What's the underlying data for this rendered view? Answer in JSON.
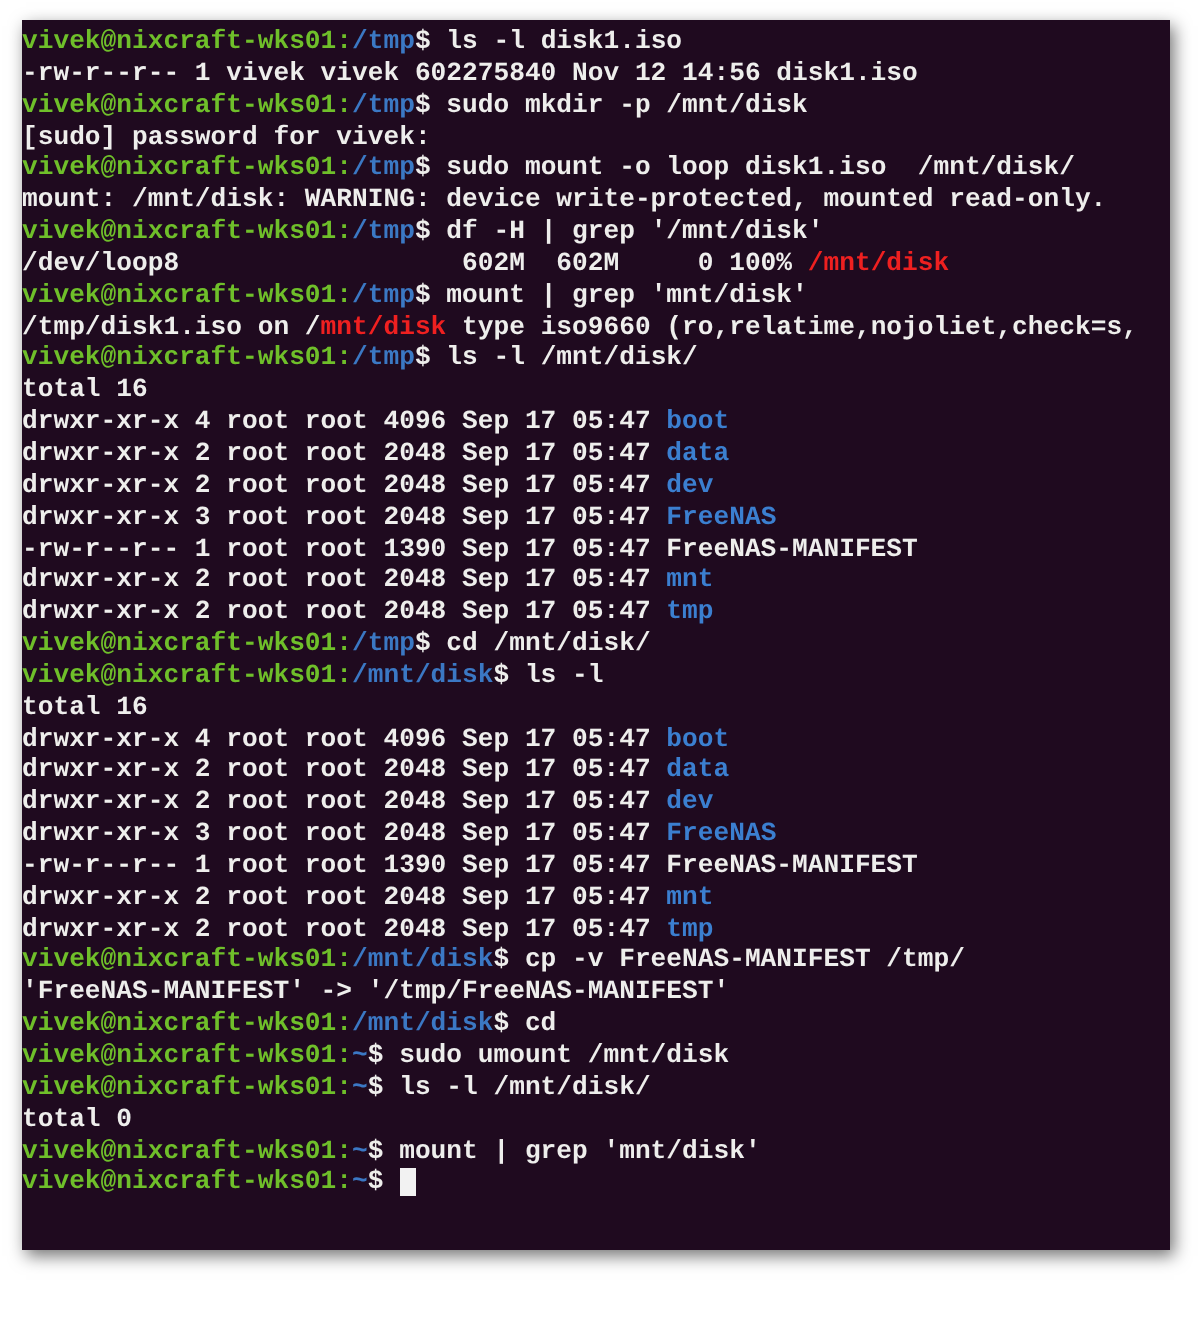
{
  "terminal": {
    "lines": [
      {
        "segments": [
          {
            "kind": "user",
            "text": "vivek@nixcraft-wks01:"
          },
          {
            "kind": "path",
            "text": "/tmp"
          },
          {
            "kind": "text",
            "text": "$ ls -l disk1.iso"
          }
        ]
      },
      {
        "segments": [
          {
            "kind": "text",
            "text": "-rw-r--r-- 1 vivek vivek 602275840 Nov 12 14:56 disk1.iso"
          }
        ]
      },
      {
        "segments": [
          {
            "kind": "user",
            "text": "vivek@nixcraft-wks01:"
          },
          {
            "kind": "path",
            "text": "/tmp"
          },
          {
            "kind": "text",
            "text": "$ sudo mkdir -p /mnt/disk"
          }
        ]
      },
      {
        "segments": [
          {
            "kind": "text",
            "text": "[sudo] password for vivek:"
          }
        ]
      },
      {
        "segments": [
          {
            "kind": "user",
            "text": "vivek@nixcraft-wks01:"
          },
          {
            "kind": "path",
            "text": "/tmp"
          },
          {
            "kind": "text",
            "text": "$ sudo mount -o loop disk1.iso  /mnt/disk/"
          }
        ]
      },
      {
        "segments": [
          {
            "kind": "text",
            "text": "mount: /mnt/disk: WARNING: device write-protected, mounted read-only."
          }
        ]
      },
      {
        "segments": [
          {
            "kind": "user",
            "text": "vivek@nixcraft-wks01:"
          },
          {
            "kind": "path",
            "text": "/tmp"
          },
          {
            "kind": "text",
            "text": "$ df -H | grep '/mnt/disk'"
          }
        ]
      },
      {
        "segments": [
          {
            "kind": "text",
            "text": "/dev/loop8                  602M  602M     0 100% "
          },
          {
            "kind": "match",
            "text": "/mnt/disk"
          }
        ]
      },
      {
        "segments": [
          {
            "kind": "user",
            "text": "vivek@nixcraft-wks01:"
          },
          {
            "kind": "path",
            "text": "/tmp"
          },
          {
            "kind": "text",
            "text": "$ mount | grep 'mnt/disk'"
          }
        ]
      },
      {
        "segments": [
          {
            "kind": "text",
            "text": "/tmp/disk1.iso on /"
          },
          {
            "kind": "match",
            "text": "mnt/disk"
          },
          {
            "kind": "text",
            "text": " type iso9660 (ro,relatime,nojoliet,check=s,"
          }
        ]
      },
      {
        "segments": [
          {
            "kind": "user",
            "text": "vivek@nixcraft-wks01:"
          },
          {
            "kind": "path",
            "text": "/tmp"
          },
          {
            "kind": "text",
            "text": "$ ls -l /mnt/disk/"
          }
        ]
      },
      {
        "segments": [
          {
            "kind": "text",
            "text": "total 16"
          }
        ]
      },
      {
        "segments": [
          {
            "kind": "text",
            "text": "drwxr-xr-x 4 root root 4096 Sep 17 05:47 "
          },
          {
            "kind": "dir",
            "text": "boot"
          }
        ]
      },
      {
        "segments": [
          {
            "kind": "text",
            "text": "drwxr-xr-x 2 root root 2048 Sep 17 05:47 "
          },
          {
            "kind": "dir",
            "text": "data"
          }
        ]
      },
      {
        "segments": [
          {
            "kind": "text",
            "text": "drwxr-xr-x 2 root root 2048 Sep 17 05:47 "
          },
          {
            "kind": "dir",
            "text": "dev"
          }
        ]
      },
      {
        "segments": [
          {
            "kind": "text",
            "text": "drwxr-xr-x 3 root root 2048 Sep 17 05:47 "
          },
          {
            "kind": "dir",
            "text": "FreeNAS"
          }
        ]
      },
      {
        "segments": [
          {
            "kind": "text",
            "text": "-rw-r--r-- 1 root root 1390 Sep 17 05:47 FreeNAS-MANIFEST"
          }
        ]
      },
      {
        "segments": [
          {
            "kind": "text",
            "text": "drwxr-xr-x 2 root root 2048 Sep 17 05:47 "
          },
          {
            "kind": "dir",
            "text": "mnt"
          }
        ]
      },
      {
        "segments": [
          {
            "kind": "text",
            "text": "drwxr-xr-x 2 root root 2048 Sep 17 05:47 "
          },
          {
            "kind": "dir",
            "text": "tmp"
          }
        ]
      },
      {
        "segments": [
          {
            "kind": "user",
            "text": "vivek@nixcraft-wks01:"
          },
          {
            "kind": "path",
            "text": "/tmp"
          },
          {
            "kind": "text",
            "text": "$ cd /mnt/disk/"
          }
        ]
      },
      {
        "segments": [
          {
            "kind": "user",
            "text": "vivek@nixcraft-wks01:"
          },
          {
            "kind": "path",
            "text": "/mnt/disk"
          },
          {
            "kind": "text",
            "text": "$ ls -l"
          }
        ]
      },
      {
        "segments": [
          {
            "kind": "text",
            "text": "total 16"
          }
        ]
      },
      {
        "segments": [
          {
            "kind": "text",
            "text": "drwxr-xr-x 4 root root 4096 Sep 17 05:47 "
          },
          {
            "kind": "dir",
            "text": "boot"
          }
        ]
      },
      {
        "segments": [
          {
            "kind": "text",
            "text": "drwxr-xr-x 2 root root 2048 Sep 17 05:47 "
          },
          {
            "kind": "dir",
            "text": "data"
          }
        ]
      },
      {
        "segments": [
          {
            "kind": "text",
            "text": "drwxr-xr-x 2 root root 2048 Sep 17 05:47 "
          },
          {
            "kind": "dir",
            "text": "dev"
          }
        ]
      },
      {
        "segments": [
          {
            "kind": "text",
            "text": "drwxr-xr-x 3 root root 2048 Sep 17 05:47 "
          },
          {
            "kind": "dir",
            "text": "FreeNAS"
          }
        ]
      },
      {
        "segments": [
          {
            "kind": "text",
            "text": "-rw-r--r-- 1 root root 1390 Sep 17 05:47 FreeNAS-MANIFEST"
          }
        ]
      },
      {
        "segments": [
          {
            "kind": "text",
            "text": "drwxr-xr-x 2 root root 2048 Sep 17 05:47 "
          },
          {
            "kind": "dir",
            "text": "mnt"
          }
        ]
      },
      {
        "segments": [
          {
            "kind": "text",
            "text": "drwxr-xr-x 2 root root 2048 Sep 17 05:47 "
          },
          {
            "kind": "dir",
            "text": "tmp"
          }
        ]
      },
      {
        "segments": [
          {
            "kind": "user",
            "text": "vivek@nixcraft-wks01:"
          },
          {
            "kind": "path",
            "text": "/mnt/disk"
          },
          {
            "kind": "text",
            "text": "$ cp -v FreeNAS-MANIFEST /tmp/"
          }
        ]
      },
      {
        "segments": [
          {
            "kind": "text",
            "text": "'FreeNAS-MANIFEST' -> '/tmp/FreeNAS-MANIFEST'"
          }
        ]
      },
      {
        "segments": [
          {
            "kind": "user",
            "text": "vivek@nixcraft-wks01:"
          },
          {
            "kind": "path",
            "text": "/mnt/disk"
          },
          {
            "kind": "text",
            "text": "$ cd"
          }
        ]
      },
      {
        "segments": [
          {
            "kind": "user",
            "text": "vivek@nixcraft-wks01:"
          },
          {
            "kind": "path",
            "text": "~"
          },
          {
            "kind": "text",
            "text": "$ sudo umount /mnt/disk"
          }
        ]
      },
      {
        "segments": [
          {
            "kind": "user",
            "text": "vivek@nixcraft-wks01:"
          },
          {
            "kind": "path",
            "text": "~"
          },
          {
            "kind": "text",
            "text": "$ ls -l /mnt/disk/"
          }
        ]
      },
      {
        "segments": [
          {
            "kind": "text",
            "text": "total 0"
          }
        ]
      },
      {
        "segments": [
          {
            "kind": "user",
            "text": "vivek@nixcraft-wks01:"
          },
          {
            "kind": "path",
            "text": "~"
          },
          {
            "kind": "text",
            "text": "$ mount | grep 'mnt/disk'"
          }
        ]
      },
      {
        "segments": [
          {
            "kind": "user",
            "text": "vivek@nixcraft-wks01:"
          },
          {
            "kind": "path",
            "text": "~"
          },
          {
            "kind": "text",
            "text": "$ "
          }
        ],
        "cursor": true
      }
    ]
  }
}
